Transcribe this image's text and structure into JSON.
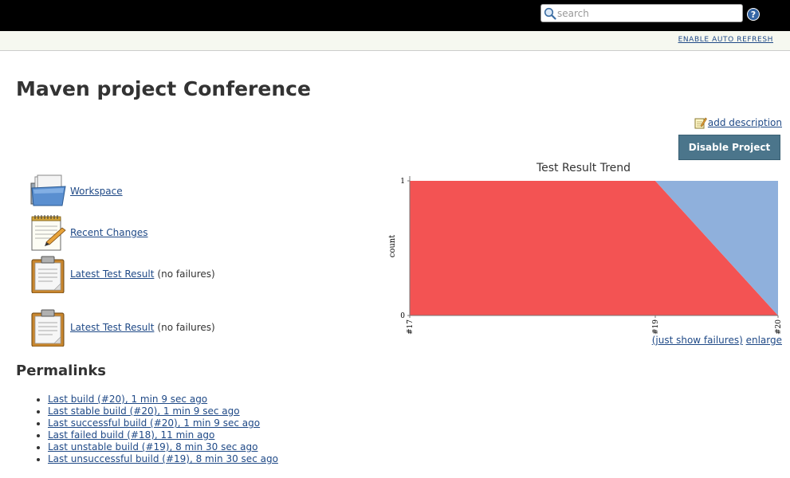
{
  "header": {
    "search": {
      "placeholder": "search",
      "value": ""
    },
    "help_icon": "help-icon"
  },
  "subbar": {
    "auto_refresh_label": "ENABLE AUTO REFRESH"
  },
  "page": {
    "title": "Maven project Conference",
    "add_description": "add description",
    "disable_button": "Disable Project"
  },
  "tasks": [
    {
      "icon": "folder-icon",
      "label": "Workspace",
      "note": ""
    },
    {
      "icon": "notepad-icon",
      "label": "Recent Changes",
      "note": ""
    },
    {
      "icon": "clipboard-icon",
      "label": "Latest Test Result",
      "note": "(no failures)"
    },
    {
      "icon": "clipboard-icon",
      "label": "Latest Test Result",
      "note": "(no failures)"
    }
  ],
  "permalinks": {
    "title": "Permalinks",
    "items": [
      "Last build (#20), 1 min 9 sec ago",
      "Last stable build (#20), 1 min 9 sec ago",
      "Last successful build (#20), 1 min 9 sec ago",
      "Last failed build (#18), 11 min ago",
      "Last unstable build (#19), 8 min 30 sec ago",
      "Last unsuccessful build (#19), 8 min 30 sec ago"
    ]
  },
  "chart_links": {
    "just_show_failures": "(just show failures)",
    "enlarge": "enlarge"
  },
  "chart_data": {
    "type": "area",
    "title": "Test Result Trend",
    "xlabel": "",
    "ylabel": "count",
    "categories": [
      "#17",
      "#19",
      "#20"
    ],
    "x_positions": [
      17,
      19,
      20
    ],
    "ylim": [
      0,
      1
    ],
    "yticks": [
      0,
      1
    ],
    "stacked": true,
    "series": [
      {
        "name": "",
        "color": "#f35353",
        "values": [
          1,
          1,
          0
        ]
      },
      {
        "name": "",
        "color": "#8fb0dc",
        "values": [
          0,
          0,
          1
        ]
      }
    ]
  },
  "colors": {
    "header_bg": "#000000",
    "subbar_bg": "#f6f8f0",
    "link": "#204A87",
    "button_bg": "#4b758b"
  }
}
